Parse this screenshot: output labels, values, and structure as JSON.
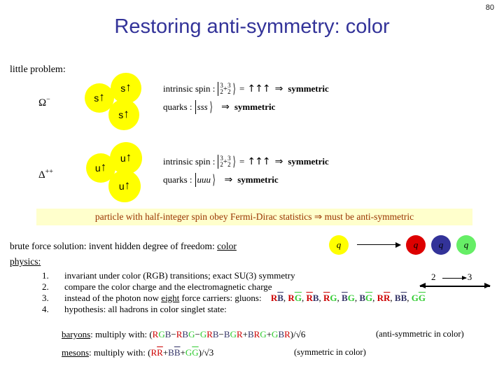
{
  "page_number": "80",
  "title": "Restoring anti-symmetry: color",
  "colors": {
    "title": "#333399",
    "banner_bg": "#ffffcc",
    "banner_text": "#993300",
    "red": "#cc0000",
    "green": "#33cc33",
    "blue": "#333366",
    "quark_yellow": "#ffff00"
  },
  "little_problem_label": "little problem:",
  "particles": [
    {
      "name": "omega-minus",
      "label_base": "Ω",
      "label_sup": "−",
      "quark_symbol": "s",
      "spin_arrow": "↑",
      "quarks": [
        "s↑",
        "s↑",
        "s↑"
      ],
      "equations": {
        "spin_label": "intrinsic spin :",
        "ket_num": "3",
        "ket_den": "2",
        "ket_plus": "+",
        "ket_num2": "3",
        "ket_den2": "2",
        "equals": "=",
        "arrows": "↑↑↑",
        "implies": "⇒",
        "spin_result": "symmetric",
        "quarks_label": "quarks :",
        "quarks_ket": "sss",
        "quarks_implies": "⇒",
        "quarks_result": "symmetric"
      }
    },
    {
      "name": "delta-plus-plus",
      "label_base": "Δ",
      "label_sup": "++",
      "quark_symbol": "u",
      "spin_arrow": "↑",
      "quarks": [
        "u↑",
        "u↑",
        "u↑"
      ],
      "equations": {
        "spin_label": "intrinsic spin :",
        "ket_num": "3",
        "ket_den": "2",
        "ket_plus": "+",
        "ket_num2": "3",
        "ket_den2": "2",
        "equals": "=",
        "arrows": "↑↑↑",
        "implies": "⇒",
        "spin_result": "symmetric",
        "quarks_label": "quarks :",
        "quarks_ket": "uuu",
        "quarks_implies": "⇒",
        "quarks_result": "symmetric"
      }
    }
  ],
  "banner_text": "particle with half-integer spin obey Fermi-Dirac statistics ⇒ must be anti-symmetric",
  "brute_force": {
    "prefix": "brute force solution: invent hidden degree of freedom: ",
    "underlined": "color"
  },
  "q_diagram": {
    "source_label": "q",
    "arrow": "⟶",
    "result_labels": [
      "q",
      "q",
      "q"
    ],
    "result_colors": [
      "#dd0000",
      "#333399",
      "#66ee66"
    ]
  },
  "two_three": {
    "from": "2",
    "to": "3"
  },
  "physics_label": "physics:",
  "physics_items": [
    {
      "num": "1.",
      "text": "invariant under color (RGB) transitions; exact SU(3) symmetry"
    },
    {
      "num": "2.",
      "text": "compare the color charge and the electromagnetic charge"
    },
    {
      "num": "3.",
      "text_pre": "instead of the photon now ",
      "text_underline": "eight",
      "text_post": " force carriers: gluons:",
      "gluons": [
        {
          "letters": [
            {
              "c": "R",
              "color": "red",
              "bar": false
            },
            {
              "c": "B",
              "color": "blue",
              "bar": true
            }
          ]
        },
        {
          "letters": [
            {
              "c": "R",
              "color": "red",
              "bar": false
            },
            {
              "c": "G",
              "color": "green",
              "bar": true
            }
          ]
        },
        {
          "letters": [
            {
              "c": "R",
              "color": "red",
              "bar": true
            },
            {
              "c": "B",
              "color": "blue",
              "bar": false
            }
          ]
        },
        {
          "letters": [
            {
              "c": "R",
              "color": "red",
              "bar": true
            },
            {
              "c": "G",
              "color": "green",
              "bar": false
            }
          ]
        },
        {
          "letters": [
            {
              "c": "B",
              "color": "blue",
              "bar": true
            },
            {
              "c": "G",
              "color": "green",
              "bar": false
            }
          ]
        },
        {
          "letters": [
            {
              "c": "B",
              "color": "blue",
              "bar": false
            },
            {
              "c": "G",
              "color": "green",
              "bar": true
            }
          ]
        },
        {
          "letters": [
            {
              "c": "R",
              "color": "red",
              "bar": false
            },
            {
              "c": "R",
              "color": "red",
              "bar": true
            }
          ]
        },
        {
          "letters": [
            {
              "c": "B",
              "color": "blue",
              "bar": false
            },
            {
              "c": "B",
              "color": "blue",
              "bar": true
            }
          ]
        },
        {
          "letters": [
            {
              "c": "G",
              "color": "green",
              "bar": false
            },
            {
              "c": "G",
              "color": "green",
              "bar": true
            }
          ]
        }
      ]
    },
    {
      "num": "4.",
      "text": "hypothesis: all hadrons in color singlet state:"
    }
  ],
  "baryons": {
    "label": "baryons",
    "prefix": ": multiply with: (",
    "terms": "RGB−RBG−GRB−BGR+BRG+GBR",
    "suffix": ")/√6",
    "note": "(anti-symmetric in color)"
  },
  "mesons": {
    "label": "mesons",
    "prefix": ": multiply with: (",
    "terms": "RR̅+BB̅+GG̅",
    "suffix": ")/√3",
    "note": "(symmetric in color)"
  }
}
